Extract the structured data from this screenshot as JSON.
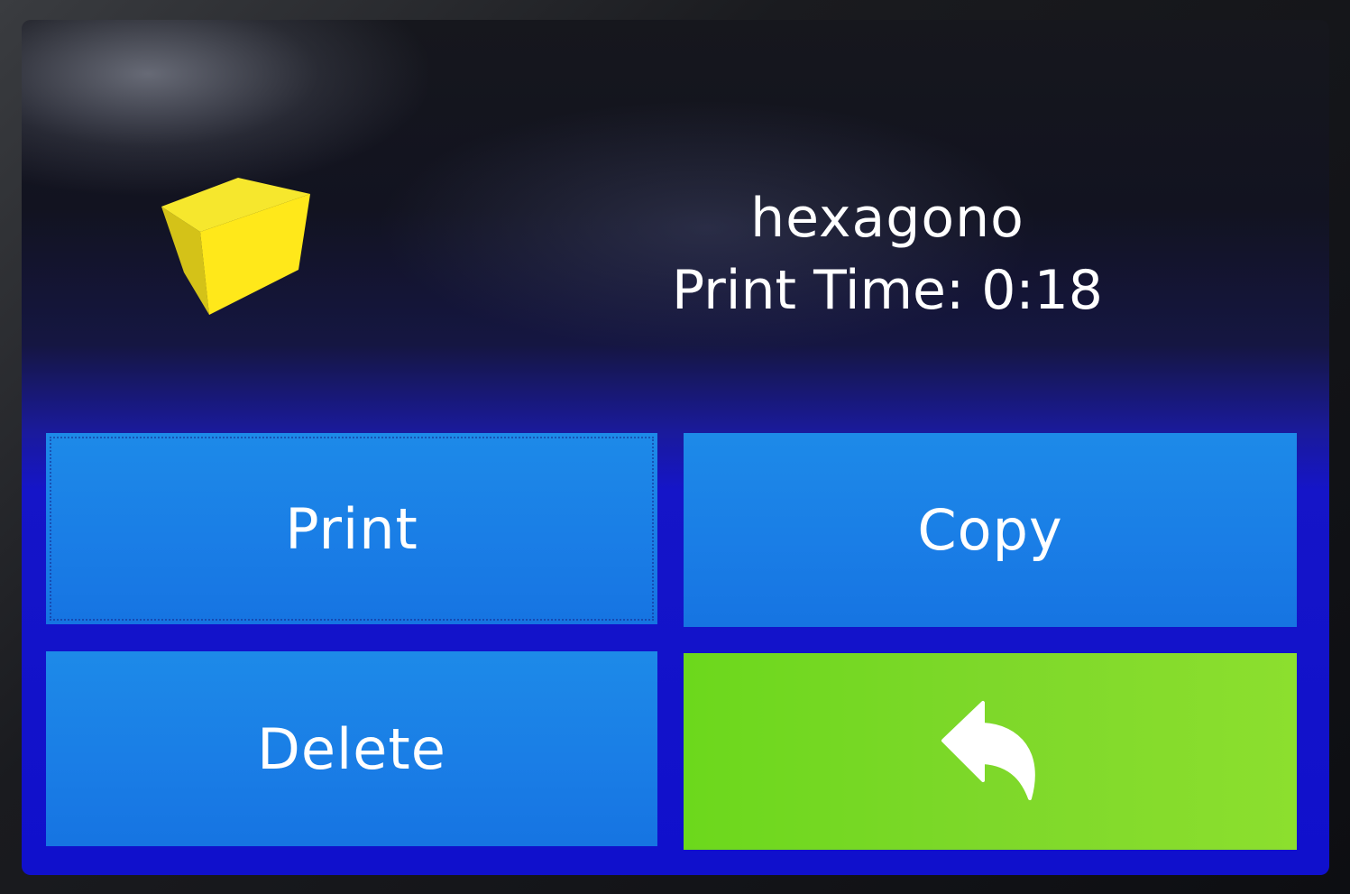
{
  "file": {
    "name": "hexagono",
    "print_time": "Print Time: 0:18",
    "thumbnail_icon": "cube-icon"
  },
  "buttons": {
    "print_label": "Print",
    "copy_label": "Copy",
    "delete_label": "Delete",
    "back_icon": "back-arrow-icon"
  },
  "colors": {
    "button_blue": "#1a7ee6",
    "button_green": "#7ed82a",
    "cube_yellow": "#ffe81a",
    "text": "#ffffff"
  }
}
